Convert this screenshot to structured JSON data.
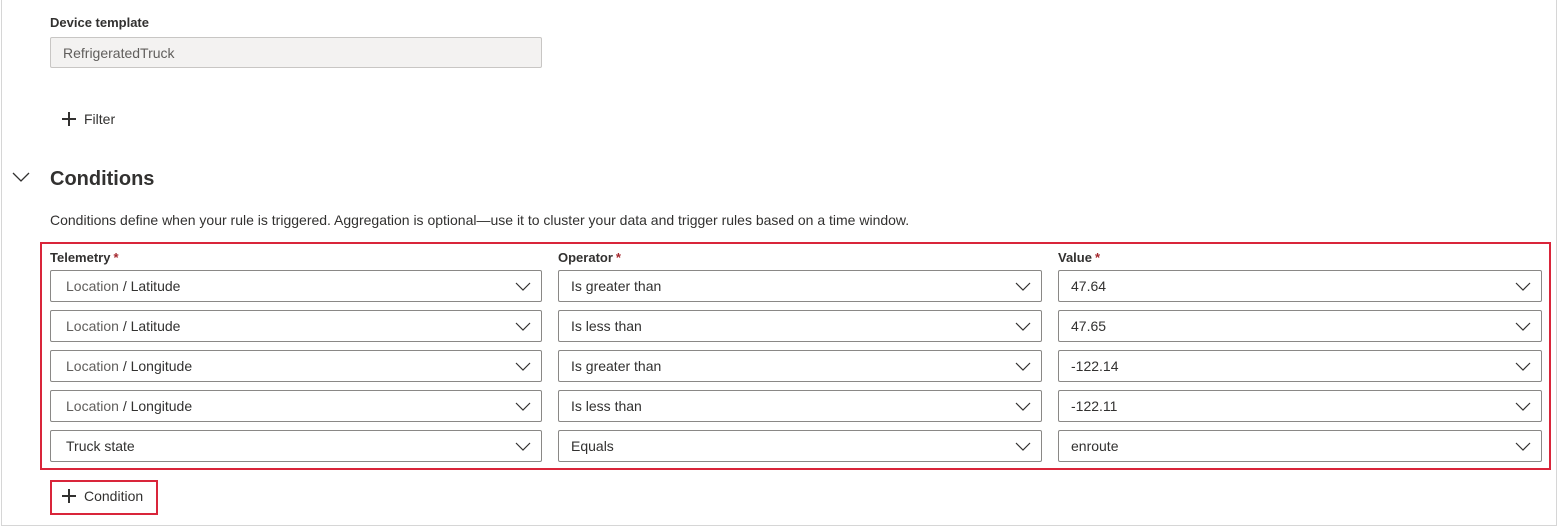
{
  "device_template": {
    "label": "Device template",
    "value": "RefrigeratedTruck"
  },
  "filter_button": {
    "label": "Filter",
    "icon": "plus-icon"
  },
  "conditions": {
    "toggle_icon": "chevron-down-icon",
    "title": "Conditions",
    "description": "Conditions define when your rule is triggered. Aggregation is optional—use it to cluster your data and trigger rules based on a time window.",
    "headers": {
      "telemetry": "Telemetry",
      "operator": "Operator",
      "value": "Value",
      "required_mark": "*"
    },
    "rows": [
      {
        "telemetry_group": "Location",
        "separator": " / ",
        "telemetry_name": "Latitude",
        "operator": "Is greater than",
        "value": "47.64"
      },
      {
        "telemetry_group": "Location",
        "separator": " / ",
        "telemetry_name": "Latitude",
        "operator": "Is less than",
        "value": "47.65"
      },
      {
        "telemetry_group": "Location",
        "separator": " / ",
        "telemetry_name": "Longitude",
        "operator": "Is greater than",
        "value": "-122.14"
      },
      {
        "telemetry_group": "Location",
        "separator": " / ",
        "telemetry_name": "Longitude",
        "operator": "Is less than",
        "value": "-122.11"
      },
      {
        "telemetry_group": "",
        "separator": "",
        "telemetry_name": "Truck state",
        "operator": "Equals",
        "value": "enroute"
      }
    ],
    "add_button": {
      "label": "Condition",
      "icon": "plus-icon"
    }
  },
  "colors": {
    "highlight": "#d9253a",
    "required": "#a4262c",
    "border": "#8a8886",
    "readonly_bg": "#f3f2f1"
  }
}
